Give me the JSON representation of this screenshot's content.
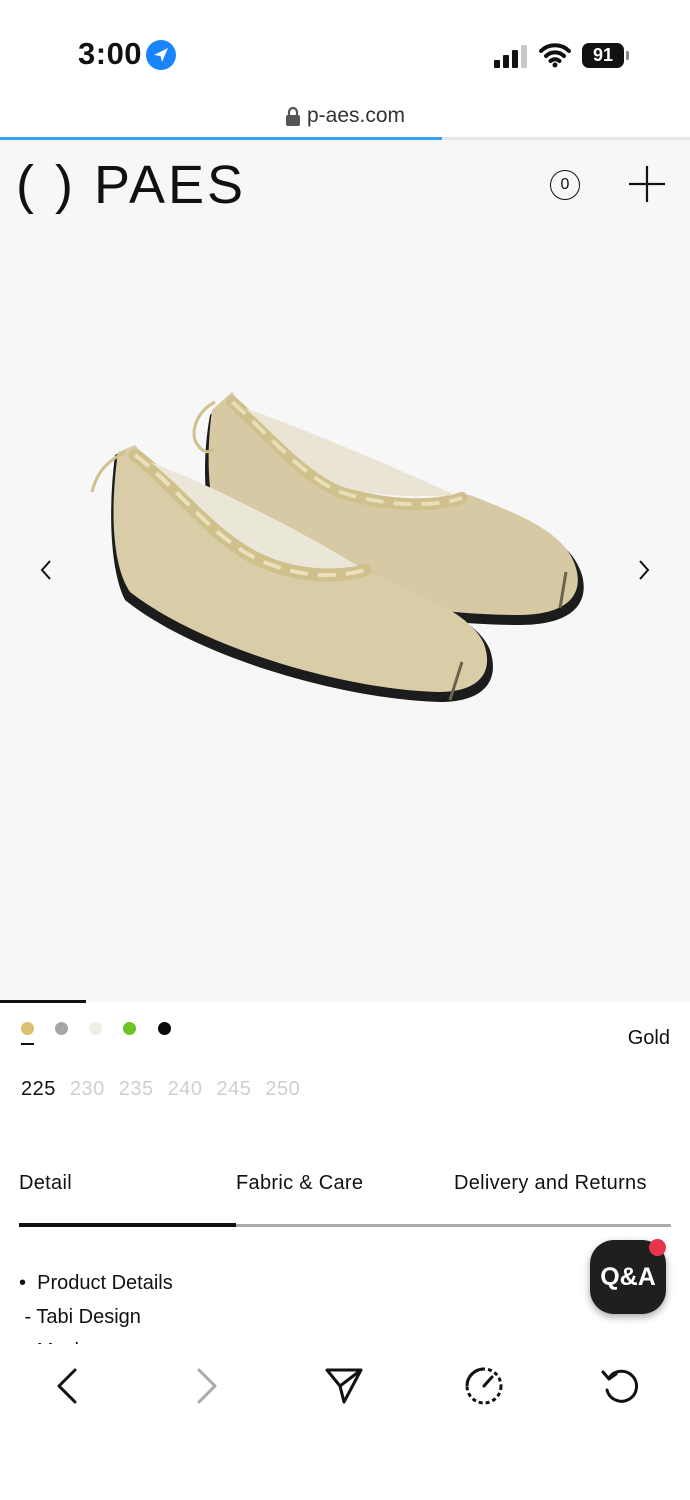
{
  "status_bar": {
    "time": "3:00",
    "battery": "91",
    "icons": [
      "location-arrow-icon",
      "signal-icon",
      "wifi-icon",
      "battery-icon"
    ]
  },
  "browser": {
    "url": "p-aes.com",
    "load_progress": 0.64,
    "toolbar": [
      "back-icon",
      "forward-icon",
      "share-icon",
      "speed-icon",
      "reload-icon"
    ]
  },
  "header": {
    "logo": "( ) PAES",
    "cart_count": "0"
  },
  "product": {
    "image": "mesh-tabi-ballet-flats-gold",
    "selected_color": "Gold",
    "colors": [
      {
        "name": "gold",
        "hex": "#d9c170"
      },
      {
        "name": "grey",
        "hex": "#a6a6a6"
      },
      {
        "name": "cream",
        "hex": "#eeefe2"
      },
      {
        "name": "green",
        "hex": "#6bc324"
      },
      {
        "name": "black",
        "hex": "#0a0a0a"
      }
    ],
    "sizes": [
      "225",
      "230",
      "235",
      "240",
      "245",
      "250"
    ],
    "selected_size": "225"
  },
  "tabs": {
    "detail": "Detail",
    "fabric": "Fabric & Care",
    "delivery": "Delivery and Returns"
  },
  "detail_lines": [
    "•  Product Details",
    " - Tabi Design",
    " - Mesh"
  ],
  "qa_label": "Q&A"
}
